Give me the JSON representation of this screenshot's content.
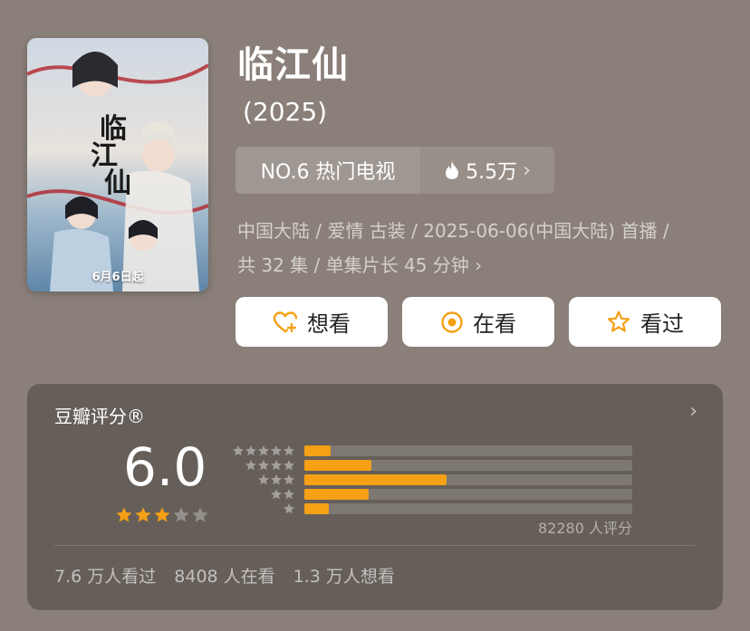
{
  "poster": {
    "date_text": "6月6日起"
  },
  "title": "临江仙",
  "year": "(2025)",
  "rank": {
    "label": "NO.6 热门电视",
    "heat": "5.5万"
  },
  "meta": {
    "line1": "中国大陆 / 爱情 古装 / 2025-06-06(中国大陆) 首播 /",
    "line2": "共 32 集 / 单集片长 45 分钟"
  },
  "actions": [
    {
      "label": "想看",
      "icon": "heart-plus-icon"
    },
    {
      "label": "在看",
      "icon": "target-icon"
    },
    {
      "label": "看过",
      "icon": "star-outline-icon"
    }
  ],
  "rating": {
    "title": "豆瓣评分®",
    "score": "6.0",
    "score_stars": 3,
    "distribution": [
      {
        "stars": 5,
        "percent": 8
      },
      {
        "stars": 4,
        "percent": 20.5
      },
      {
        "stars": 3,
        "percent": 43.5
      },
      {
        "stars": 2,
        "percent": 19.5
      },
      {
        "stars": 1,
        "percent": 7.5
      }
    ],
    "count_text": "82280 人评分"
  },
  "stats": {
    "watched": "7.6 万人看过",
    "watching": "8408 人在看",
    "want": "1.3 万人想看"
  },
  "colors": {
    "accent": "#f5a015",
    "background": "#8a8079",
    "card": "#665f59"
  }
}
